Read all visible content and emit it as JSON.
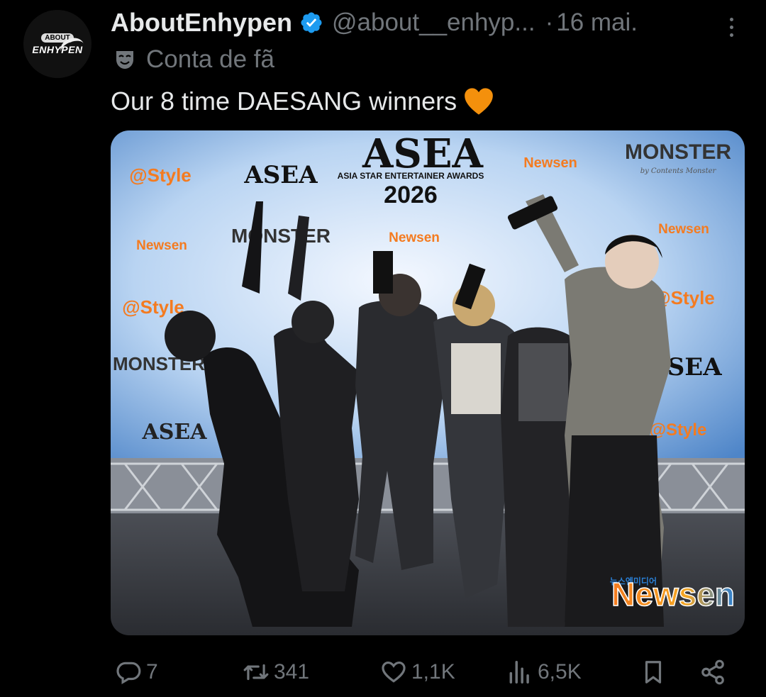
{
  "post": {
    "avatar": {
      "icon": "enhypen-logo-avatar",
      "top_text": "ABOUT",
      "logo_text": "ENHYPEN"
    },
    "author_name": "AboutEnhypen",
    "verified_icon": "verified-badge-icon",
    "handle": "@about__enhyp...",
    "separator": "·",
    "date": "16 mai.",
    "fan_icon": "theater-mask-icon",
    "fan_label": "Conta de fã",
    "text": "Our 8 time DAESANG winners",
    "text_emoji": "orange-heart-emoji"
  },
  "media": {
    "backdrop": {
      "event_logo": "ASEA",
      "event_name": "ASIA STAR ENTERTAINER AWARDS",
      "event_year": "2026",
      "sponsor_newsen": "Newsen",
      "sponsor_newsen_kr": "뉴스엔미디어",
      "sponsor_monster": "MONSTER",
      "sponsor_monster_sub": "by Contents Monster",
      "sponsor_style": "@Style",
      "small_asea": "ASEA"
    },
    "watermark": "Newsen",
    "watermark_kr": "뉴스엔미디어"
  },
  "actions": {
    "reply": {
      "icon": "reply-icon",
      "count": "7"
    },
    "retweet": {
      "icon": "retweet-icon",
      "count": "341"
    },
    "like": {
      "icon": "like-icon",
      "count": "1,1K"
    },
    "views": {
      "icon": "views-icon",
      "count": "6,5K"
    },
    "bookmark": {
      "icon": "bookmark-icon"
    },
    "share": {
      "icon": "share-icon"
    }
  },
  "colors": {
    "background": "#000000",
    "text_primary": "#e7e9ea",
    "text_secondary": "#71767b",
    "verified_blue": "#1d9bf0",
    "heart_orange": "#f4900c",
    "newsen_orange": "#f47b20",
    "newsen_blue": "#2a7fd4"
  }
}
